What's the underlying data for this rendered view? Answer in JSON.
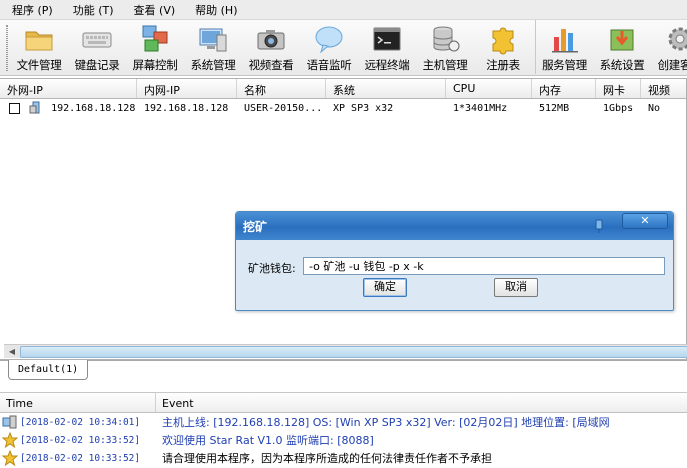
{
  "menu": [
    "程序 (P)",
    "功能 (T)",
    "查看 (V)",
    "帮助 (H)"
  ],
  "toolbar": [
    {
      "label": "文件管理",
      "icon": "folder-icon"
    },
    {
      "label": "键盘记录",
      "icon": "keyboard-icon"
    },
    {
      "label": "屏幕控制",
      "icon": "screen-control-icon"
    },
    {
      "label": "系统管理",
      "icon": "system-manage-icon"
    },
    {
      "label": "视频查看",
      "icon": "camera-icon"
    },
    {
      "label": "语音监听",
      "icon": "speech-bubble-icon"
    },
    {
      "label": "远程终端",
      "icon": "terminal-icon"
    },
    {
      "label": "主机管理",
      "icon": "database-icon"
    },
    {
      "label": "注册表",
      "icon": "puzzle-icon"
    },
    {
      "label": "服务管理",
      "icon": "bar-chart-icon"
    },
    {
      "label": "系统设置",
      "icon": "settings-box-icon"
    },
    {
      "label": "创建客户",
      "icon": "gear-icon"
    }
  ],
  "list": {
    "columns": [
      "外网-IP",
      "内网-IP",
      "名称",
      "系统",
      "CPU",
      "内存",
      "网卡",
      "视频"
    ],
    "rows": [
      {
        "wan_ip": "192.168.18.128",
        "lan_ip": "192.168.18.128",
        "name": "USER-20150...",
        "os": "XP SP3 x32",
        "cpu": "1*3401MHz",
        "memory": "512MB",
        "nic": "1Gbps",
        "video": "No"
      }
    ]
  },
  "tab": {
    "label": "Default(1)"
  },
  "dialog": {
    "title": "挖矿",
    "field_label": "矿池钱包:",
    "field_value": "-o 矿池 -u 钱包 -p x -k",
    "ok_label": "确定",
    "cancel_label": "取消",
    "close_glyph": "✕"
  },
  "log": {
    "columns": [
      "Time",
      "Event"
    ],
    "rows": [
      {
        "time": "[2018-02-02 10:34:01]",
        "event": "主机上线: [192.168.18.128]   OS: [Win XP SP3 x32]   Ver: [02月02日]   地理位置: [局域网",
        "icon": "computer-icon",
        "color": "#1f3fb0"
      },
      {
        "time": "[2018-02-02 10:33:52]",
        "event": "欢迎使用 Star Rat  V1.0   监听端口: [8088]",
        "icon": "star-icon",
        "color": "#1f3fb0"
      },
      {
        "time": "[2018-02-02 10:33:52]",
        "event": "请合理使用本程序，因为本程序所造成的任何法律责任作者不予承担",
        "icon": "star-icon",
        "color": "#000000"
      }
    ]
  },
  "colors": {
    "accent": "#2a6fbe",
    "dialog_bg": "#dce9f5",
    "log_blue": "#1f3fb0"
  }
}
